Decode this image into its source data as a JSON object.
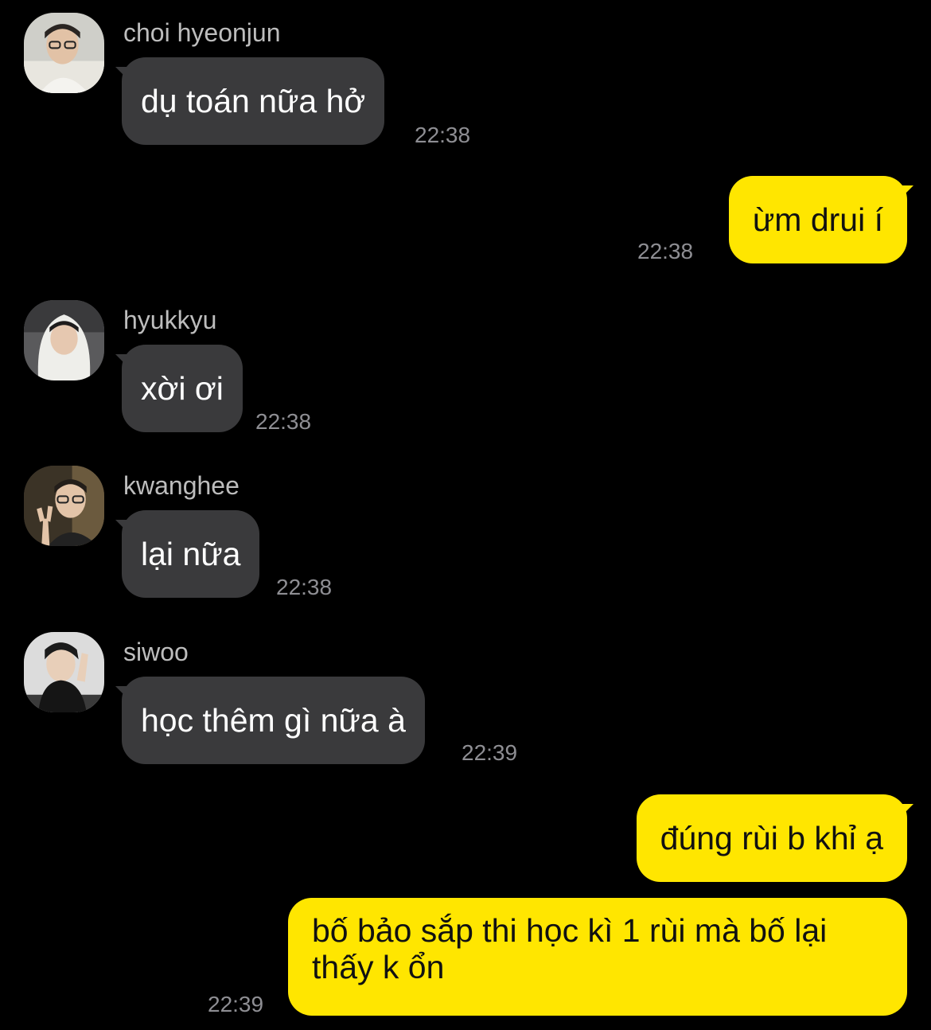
{
  "messages": [
    {
      "sender": "choi hyeonjun",
      "avatar_icon": "profile-photo-icon",
      "text": "dụ toán nữa hở",
      "time": "22:38"
    },
    {
      "sender": "me",
      "text": "ừm drui í",
      "time": "22:38"
    },
    {
      "sender": "hyukkyu",
      "avatar_icon": "profile-photo-icon",
      "text": "xời ơi",
      "time": "22:38"
    },
    {
      "sender": "kwanghee",
      "avatar_icon": "profile-photo-icon",
      "text": "lại nữa",
      "time": "22:38"
    },
    {
      "sender": "siwoo",
      "avatar_icon": "profile-photo-icon",
      "text": "học thêm gì nữa à",
      "time": "22:39"
    },
    {
      "sender": "me",
      "text": "đúng rùi b khỉ ạ",
      "time": ""
    },
    {
      "sender": "me",
      "text": "bố bảo sắp thi học kì 1 rùi mà bố lại thấy k ổn",
      "time": "22:39"
    }
  ],
  "colors": {
    "background": "#000000",
    "incoming_bubble": "#3a3a3c",
    "outgoing_bubble": "#ffe600",
    "timestamp": "#8e8e93",
    "sender_name": "#bdbdbd"
  }
}
